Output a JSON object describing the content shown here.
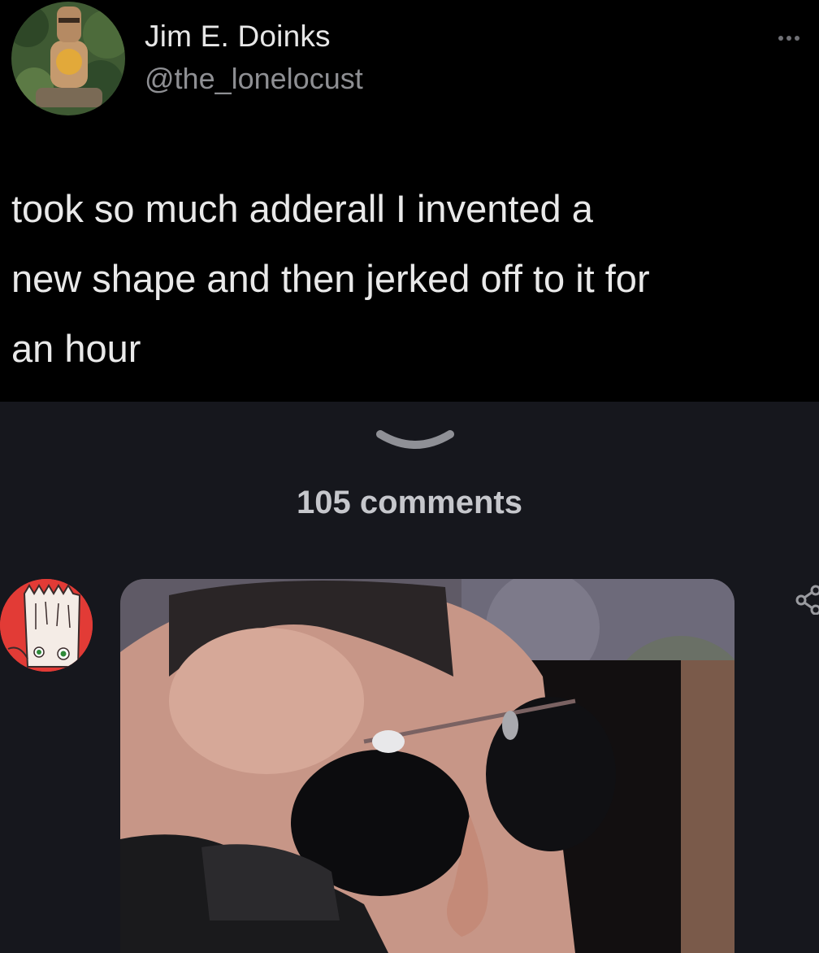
{
  "tweet": {
    "author": {
      "name": "Jim E. Doinks",
      "handle": "@the_lonelocust"
    },
    "more_icon": "more-horizontal-icon",
    "text_lines": [
      "took so much adderall I invented a",
      "new shape and then jerked off to it for",
      "an hour"
    ]
  },
  "thread": {
    "expand_icon": "chevron-down-icon",
    "comments_count_label": "105 comments"
  },
  "comment": {
    "share_icon": "share-icon"
  },
  "colors": {
    "tweet_background": "#000000",
    "page_background": "#16171d",
    "name_text": "#e7e7e7",
    "handle_text": "#8e8f93",
    "comments_text": "#c6c7cc",
    "commenter_avatar_bg": "#e23b36"
  }
}
